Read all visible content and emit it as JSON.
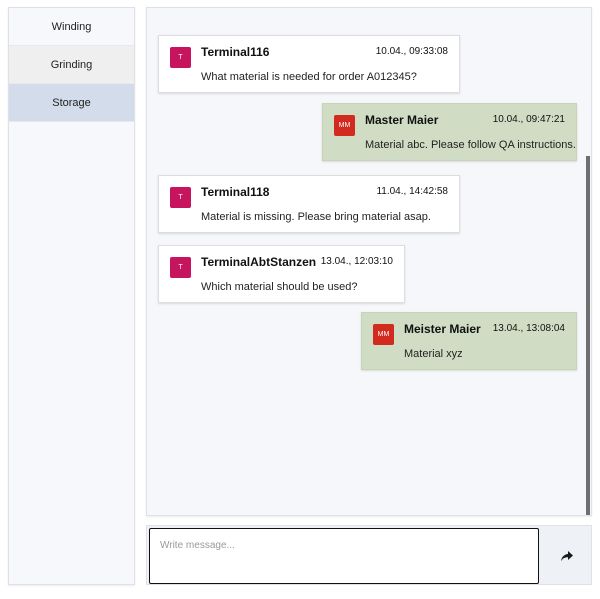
{
  "sidebar": {
    "items": [
      {
        "label": "Winding"
      },
      {
        "label": "Grinding"
      },
      {
        "label": "Storage"
      }
    ]
  },
  "messages": [
    {
      "avatar": "T",
      "sender": "Terminal116",
      "time": "10.04., 09:33:08",
      "text": "What material is needed for order A012345?"
    },
    {
      "avatar": "MM",
      "sender": "Master Maier",
      "time": "10.04., 09:47:21",
      "text": "Material abc. Please follow QA instructions."
    },
    {
      "avatar": "T",
      "sender": "Terminal118",
      "time": "11.04., 14:42:58",
      "text": "Material is missing. Please bring material asap."
    },
    {
      "avatar": "T",
      "sender": "TerminalAbtStanzen",
      "time": "13.04., 12:03:10",
      "text": "Which material should be used?"
    },
    {
      "avatar": "MM",
      "sender": "Meister Maier",
      "time": "13.04., 13:08:04",
      "text": "Material xyz"
    }
  ],
  "composer": {
    "placeholder": "Write message...",
    "send_icon": "send-arrow-icon"
  },
  "colors": {
    "terminal_avatar": "#c6145f",
    "master_avatar": "#d22a1f",
    "own_message_bg": "#d0ddc4",
    "active_sidebar_bg": "#d3dcea"
  }
}
